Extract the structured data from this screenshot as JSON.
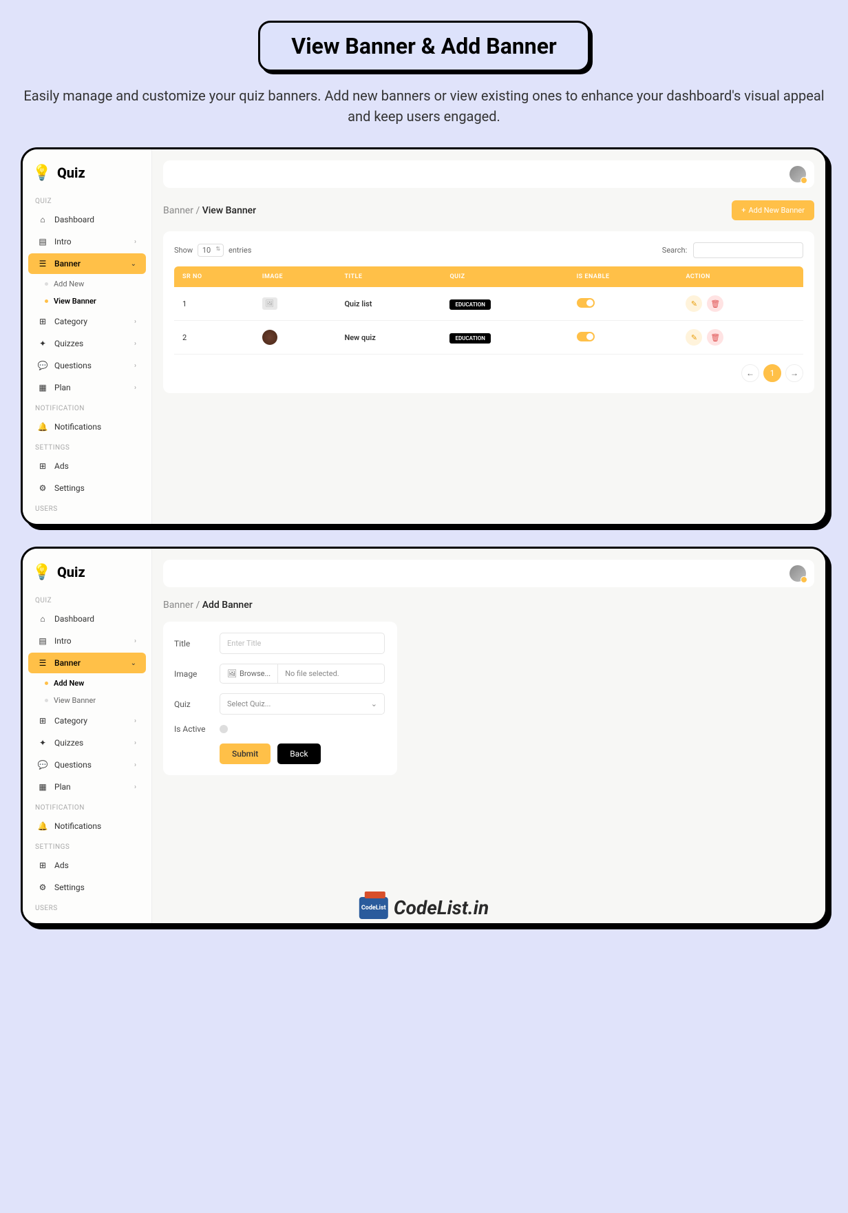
{
  "header": {
    "title": "View Banner & Add Banner",
    "subtitle": "Easily manage and customize your quiz banners. Add new banners or view existing ones to enhance your dashboard's visual appeal and keep users engaged."
  },
  "sidebar": {
    "logo": "Quiz",
    "sections": {
      "quiz": "QUIZ",
      "notification": "NOTIFICATION",
      "settings": "SETTINGS",
      "users": "USERS"
    },
    "items": {
      "dashboard": "Dashboard",
      "intro": "Intro",
      "banner": "Banner",
      "addNew": "Add New",
      "viewBanner": "View Banner",
      "category": "Category",
      "quizzes": "Quizzes",
      "questions": "Questions",
      "plan": "Plan",
      "notifications": "Notifications",
      "ads": "Ads",
      "settingsItem": "Settings"
    }
  },
  "view": {
    "breadcrumb_root": "Banner",
    "breadcrumb_sep": " / ",
    "breadcrumb_current": "View Banner",
    "addButton": "Add New Banner",
    "show": "Show",
    "pageSize": "10",
    "entries": "entries",
    "search": "Search:",
    "columns": {
      "srno": "SR NO",
      "image": "IMAGE",
      "title": "TITLE",
      "quiz": "QUIZ",
      "isEnable": "IS ENABLE",
      "action": "ACTION"
    },
    "rows": [
      {
        "sr": "1",
        "title": "Quiz list",
        "quiz": "EDUCATION"
      },
      {
        "sr": "2",
        "title": "New quiz",
        "quiz": "EDUCATION"
      }
    ],
    "currentPage": "1"
  },
  "add": {
    "breadcrumb_root": "Banner",
    "breadcrumb_sep": " / ",
    "breadcrumb_current": "Add Banner",
    "labels": {
      "title": "Title",
      "image": "Image",
      "quiz": "Quiz",
      "isActive": "Is Active"
    },
    "placeholders": {
      "title": "Enter Title",
      "browse": "Browse...",
      "noFile": "No file selected.",
      "selectQuiz": "Select Quiz..."
    },
    "buttons": {
      "submit": "Submit",
      "back": "Back"
    }
  },
  "watermark": "CodeList.in"
}
